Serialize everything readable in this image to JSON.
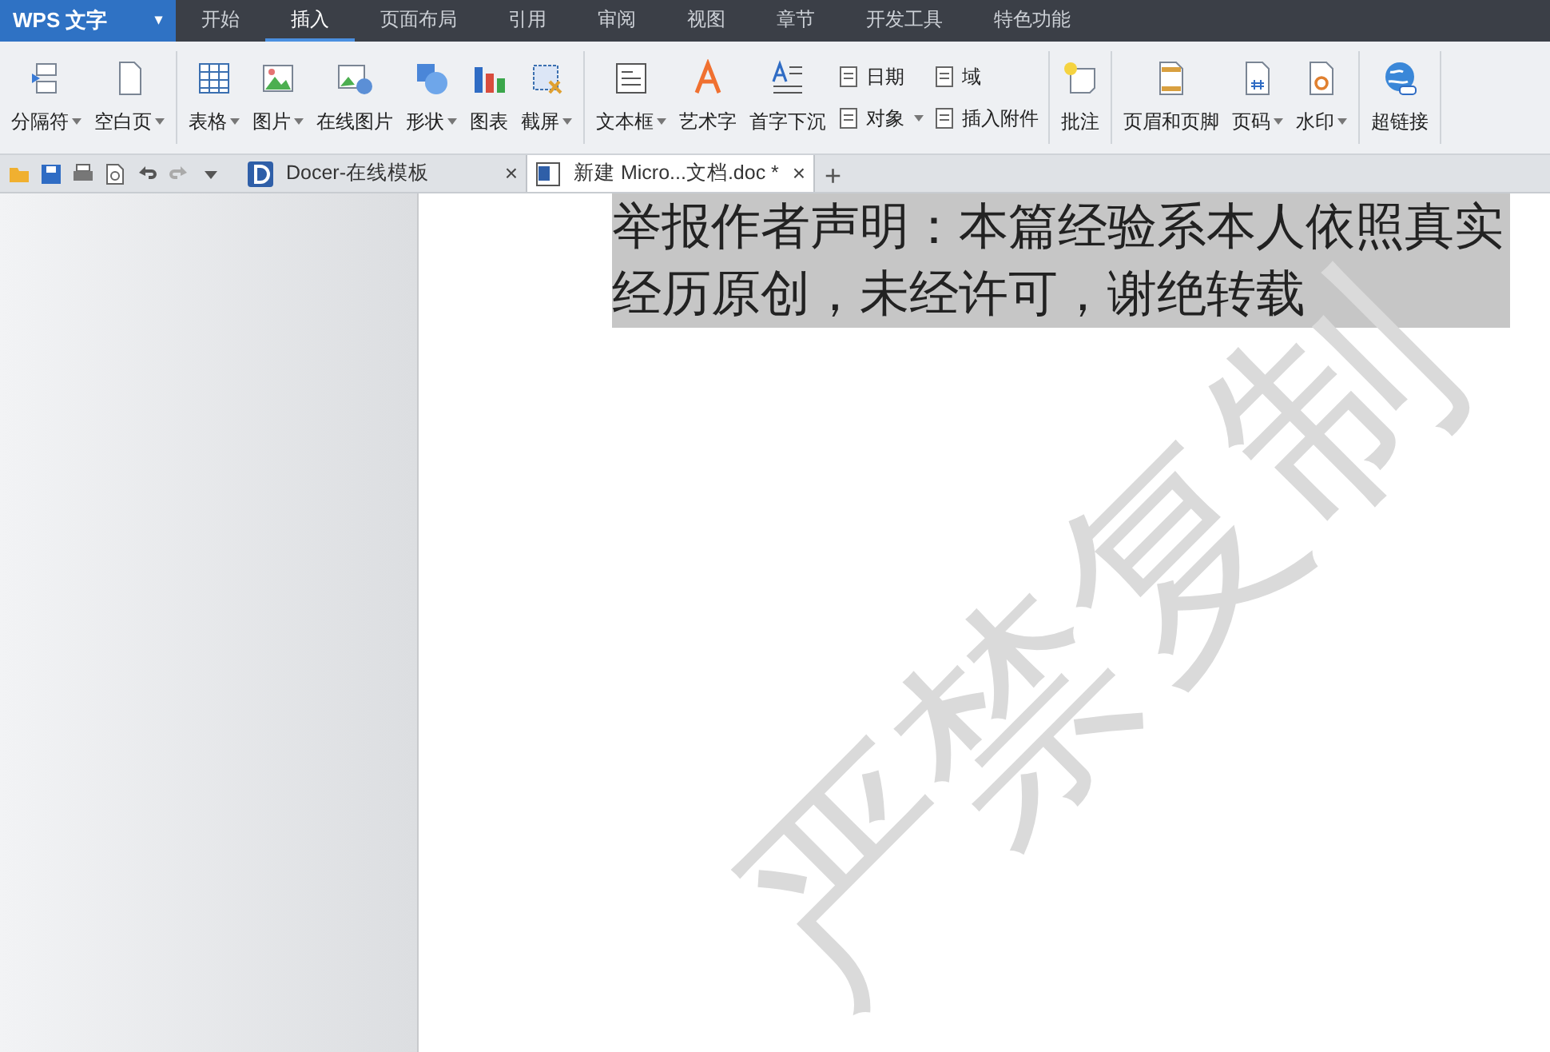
{
  "app_button": {
    "label": "WPS 文字",
    "caret": "▾"
  },
  "menu_tabs": [
    {
      "label": "开始",
      "selected": false
    },
    {
      "label": "插入",
      "selected": true
    },
    {
      "label": "页面布局",
      "selected": false
    },
    {
      "label": "引用",
      "selected": false
    },
    {
      "label": "审阅",
      "selected": false
    },
    {
      "label": "视图",
      "selected": false
    },
    {
      "label": "章节",
      "selected": false
    },
    {
      "label": "开发工具",
      "selected": false
    },
    {
      "label": "特色功能",
      "selected": false
    }
  ],
  "ribbon_groups": [
    {
      "items": [
        {
          "kind": "big",
          "label": "分隔符",
          "dropdown": true
        },
        {
          "kind": "big",
          "label": "空白页",
          "dropdown": true
        }
      ]
    },
    {
      "items": [
        {
          "kind": "big",
          "label": "表格",
          "dropdown": true
        },
        {
          "kind": "big",
          "label": "图片",
          "dropdown": true
        },
        {
          "kind": "big",
          "label": "在线图片",
          "dropdown": false
        },
        {
          "kind": "big",
          "label": "形状",
          "dropdown": true
        },
        {
          "kind": "big",
          "label": "图表",
          "dropdown": false
        },
        {
          "kind": "big",
          "label": "截屏",
          "dropdown": true
        }
      ]
    },
    {
      "items": [
        {
          "kind": "big",
          "label": "文本框",
          "dropdown": true
        },
        {
          "kind": "big",
          "label": "艺术字",
          "dropdown": false
        },
        {
          "kind": "big",
          "label": "首字下沉",
          "dropdown": false
        },
        {
          "kind": "small",
          "top": "日期",
          "bottom": "对象",
          "dropdown": true
        },
        {
          "kind": "small",
          "top": "域",
          "bottom": "插入附件",
          "dropdown": false
        }
      ]
    },
    {
      "items": [
        {
          "kind": "big",
          "label": "批注",
          "dropdown": false
        }
      ]
    },
    {
      "items": [
        {
          "kind": "big",
          "label": "页眉和页脚",
          "dropdown": false
        },
        {
          "kind": "big",
          "label": "页码",
          "dropdown": true
        },
        {
          "kind": "big",
          "label": "水印",
          "dropdown": true
        }
      ]
    },
    {
      "items": [
        {
          "kind": "big",
          "label": "超链接",
          "dropdown": false
        }
      ]
    }
  ],
  "doc_tabs": [
    {
      "label": "Docer-在线模板",
      "selected": false,
      "close": "×"
    },
    {
      "label": "新建 Micro...文档.doc *",
      "selected": true,
      "close": "×"
    }
  ],
  "new_tab": "+",
  "document": {
    "lines": [
      {
        "text": "举报作者声明：本篇经验系本人依照真实",
        "selected": true
      },
      {
        "text": "经历原创，未经许可，谢绝转载",
        "selected": true
      }
    ],
    "watermark": "严禁复制"
  }
}
